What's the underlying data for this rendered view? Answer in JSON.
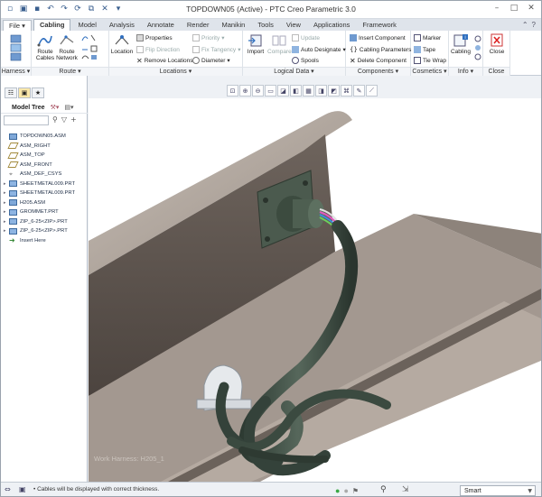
{
  "window": {
    "title": "TOPDOWN05 (Active) - PTC Creo Parametric 3.0"
  },
  "tabs": [
    "File",
    "Cabling",
    "Model",
    "Analysis",
    "Annotate",
    "Render",
    "Manikin",
    "Tools",
    "View",
    "Applications",
    "Framework"
  ],
  "active_tab": "Cabling",
  "ribbon": {
    "groups": [
      {
        "label": "Harness",
        "arrow": "▾"
      },
      {
        "label": "Route",
        "arrow": "▾"
      },
      {
        "label": "Locations",
        "arrow": "▾"
      },
      {
        "label": "Logical Data",
        "arrow": "▾"
      },
      {
        "label": "Components",
        "arrow": "▾"
      },
      {
        "label": "Cosmetics",
        "arrow": "▾"
      },
      {
        "label": "Info",
        "arrow": "▾"
      },
      {
        "label": "Close",
        "arrow": ""
      }
    ],
    "route_cables": "Route Cables",
    "route_network": "Route Network",
    "location": "Location",
    "properties": "Properties",
    "flip_direction": "Flip Direction",
    "remove_locations": "Remove Locations",
    "priority": "Priority",
    "fix_tangency": "Fix Tangency",
    "diameter": "Diameter",
    "import": "Import",
    "compare": "Compare",
    "update": "Update",
    "auto_designate": "Auto Designate",
    "spools": "Spools",
    "insert_component": "Insert Component",
    "cabling_parameters": "Cabling Parameters",
    "delete_component": "Delete Component",
    "marker": "Marker",
    "tape": "Tape",
    "tie_wrap": "Tie Wrap",
    "cabling_info": "Cabling",
    "close": "Close"
  },
  "model_tree": {
    "title": "Model Tree",
    "items": [
      {
        "label": "TOPDOWN05.ASM",
        "kind": "asm"
      },
      {
        "label": "ASM_RIGHT",
        "kind": "plane"
      },
      {
        "label": "ASM_TOP",
        "kind": "plane"
      },
      {
        "label": "ASM_FRONT",
        "kind": "plane"
      },
      {
        "label": "ASM_DEF_CSYS",
        "kind": "csys"
      },
      {
        "label": "SHEETMETAL009.PRT",
        "kind": "part"
      },
      {
        "label": "SHEETMETAL009.PRT",
        "kind": "part"
      },
      {
        "label": "H205.ASM",
        "kind": "asm"
      },
      {
        "label": "GROMMET.PRT",
        "kind": "part"
      },
      {
        "label": "ZIP_6-25<ZIP>.PRT",
        "kind": "part"
      },
      {
        "label": "ZIP_6-25<ZIP>.PRT",
        "kind": "part"
      },
      {
        "label": "Insert Here",
        "kind": "insert"
      }
    ]
  },
  "viewport": {
    "harness_label": "Work Harness: H205_1"
  },
  "status": {
    "message": "Cables will be displayed with correct thickness.",
    "filter": "Smart"
  },
  "colors": {
    "accent": "#2f6fbf",
    "ribbon_bg": "#ffffff",
    "tab_strip": "#dfe4eb",
    "model_top": "#a59a90",
    "model_shadow": "#5d544d",
    "cable": "#3a4a40"
  }
}
